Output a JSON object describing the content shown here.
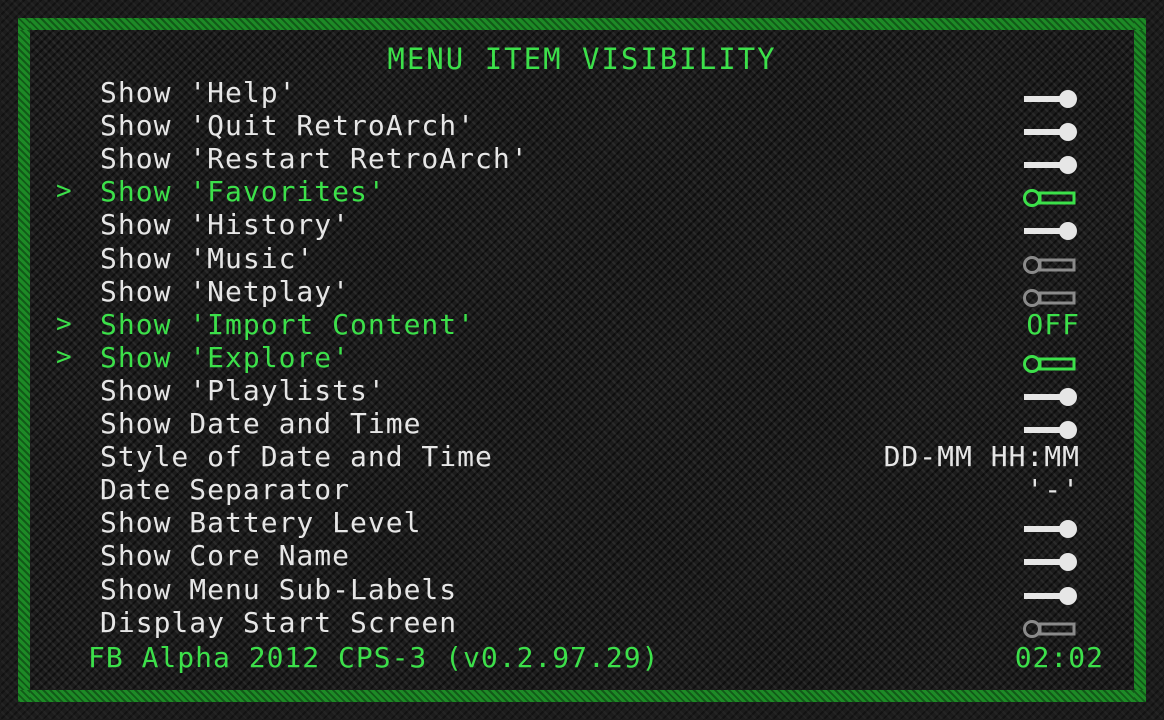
{
  "title": "MENU ITEM VISIBILITY",
  "cursor_glyph": ">",
  "colors": {
    "selected": "#3ce04a",
    "normal": "#e6e6e6",
    "disabled": "#8a8a8a",
    "frame": "#1d8a26"
  },
  "items": [
    {
      "label": "Show 'Help'",
      "value_type": "toggle",
      "state": "on",
      "selected": false
    },
    {
      "label": "Show 'Quit RetroArch'",
      "value_type": "toggle",
      "state": "on",
      "selected": false
    },
    {
      "label": "Show 'Restart RetroArch'",
      "value_type": "toggle",
      "state": "on",
      "selected": false
    },
    {
      "label": "Show 'Favorites'",
      "value_type": "toggle",
      "state": "off",
      "selected": true
    },
    {
      "label": "Show 'History'",
      "value_type": "toggle",
      "state": "on",
      "selected": false
    },
    {
      "label": "Show 'Music'",
      "value_type": "toggle",
      "state": "off-dim",
      "selected": false
    },
    {
      "label": "Show 'Netplay'",
      "value_type": "toggle",
      "state": "off-dim",
      "selected": false
    },
    {
      "label": "Show 'Import Content'",
      "value_type": "text",
      "value": "OFF",
      "selected": true
    },
    {
      "label": "Show 'Explore'",
      "value_type": "toggle",
      "state": "off",
      "selected": true
    },
    {
      "label": "Show 'Playlists'",
      "value_type": "toggle",
      "state": "on",
      "selected": false
    },
    {
      "label": "Show Date and Time",
      "value_type": "toggle",
      "state": "on",
      "selected": false
    },
    {
      "label": "Style of Date and Time",
      "value_type": "text",
      "value": "DD-MM HH:MM",
      "selected": false
    },
    {
      "label": "Date Separator",
      "value_type": "text",
      "value": "'-'",
      "selected": false
    },
    {
      "label": "Show Battery Level",
      "value_type": "toggle",
      "state": "on",
      "selected": false
    },
    {
      "label": "Show Core Name",
      "value_type": "toggle",
      "state": "on",
      "selected": false
    },
    {
      "label": "Show Menu Sub-Labels",
      "value_type": "toggle",
      "state": "on",
      "selected": false
    },
    {
      "label": "Display Start Screen",
      "value_type": "toggle",
      "state": "off-dim",
      "selected": false
    }
  ],
  "footer": {
    "core": "FB Alpha 2012 CPS-3 (v0.2.97.29)",
    "clock": "02:02"
  }
}
